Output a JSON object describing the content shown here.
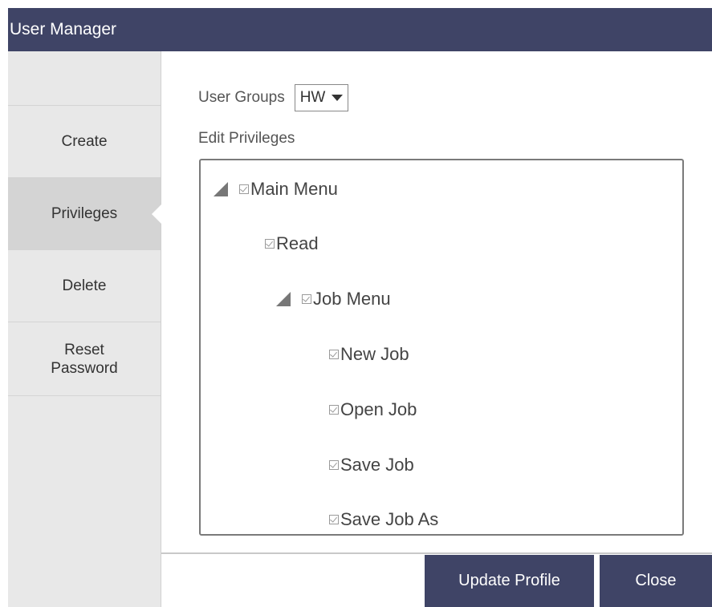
{
  "window": {
    "title": "User Manager"
  },
  "sidebar": {
    "items": [
      {
        "label": "Create"
      },
      {
        "label": "Privileges"
      },
      {
        "label": "Delete"
      },
      {
        "label": "Reset\nPassword"
      }
    ],
    "active": "Privileges"
  },
  "groups": {
    "label": "User Groups",
    "selected": "HW"
  },
  "privileges": {
    "label": "Edit Privileges",
    "tree": [
      {
        "label": "Main Menu",
        "checked": true,
        "expandable": true,
        "expanded": true,
        "depth": 0
      },
      {
        "label": "Read",
        "checked": true,
        "expandable": false,
        "depth": 1
      },
      {
        "label": "Job Menu",
        "checked": true,
        "expandable": true,
        "expanded": true,
        "depth": 1
      },
      {
        "label": "New Job",
        "checked": true,
        "expandable": false,
        "depth": 2
      },
      {
        "label": "Open Job",
        "checked": true,
        "expandable": false,
        "depth": 2
      },
      {
        "label": "Save Job",
        "checked": true,
        "expandable": false,
        "depth": 2
      },
      {
        "label": "Save Job As",
        "checked": true,
        "expandable": false,
        "depth": 2
      }
    ]
  },
  "buttons": {
    "update": "Update Profile",
    "close": "Close"
  },
  "colors": {
    "titlebar": "#3f4466",
    "button": "#3f4466",
    "sidebar": "#e8e8e8",
    "sidebar_active": "#d4d4d4"
  }
}
